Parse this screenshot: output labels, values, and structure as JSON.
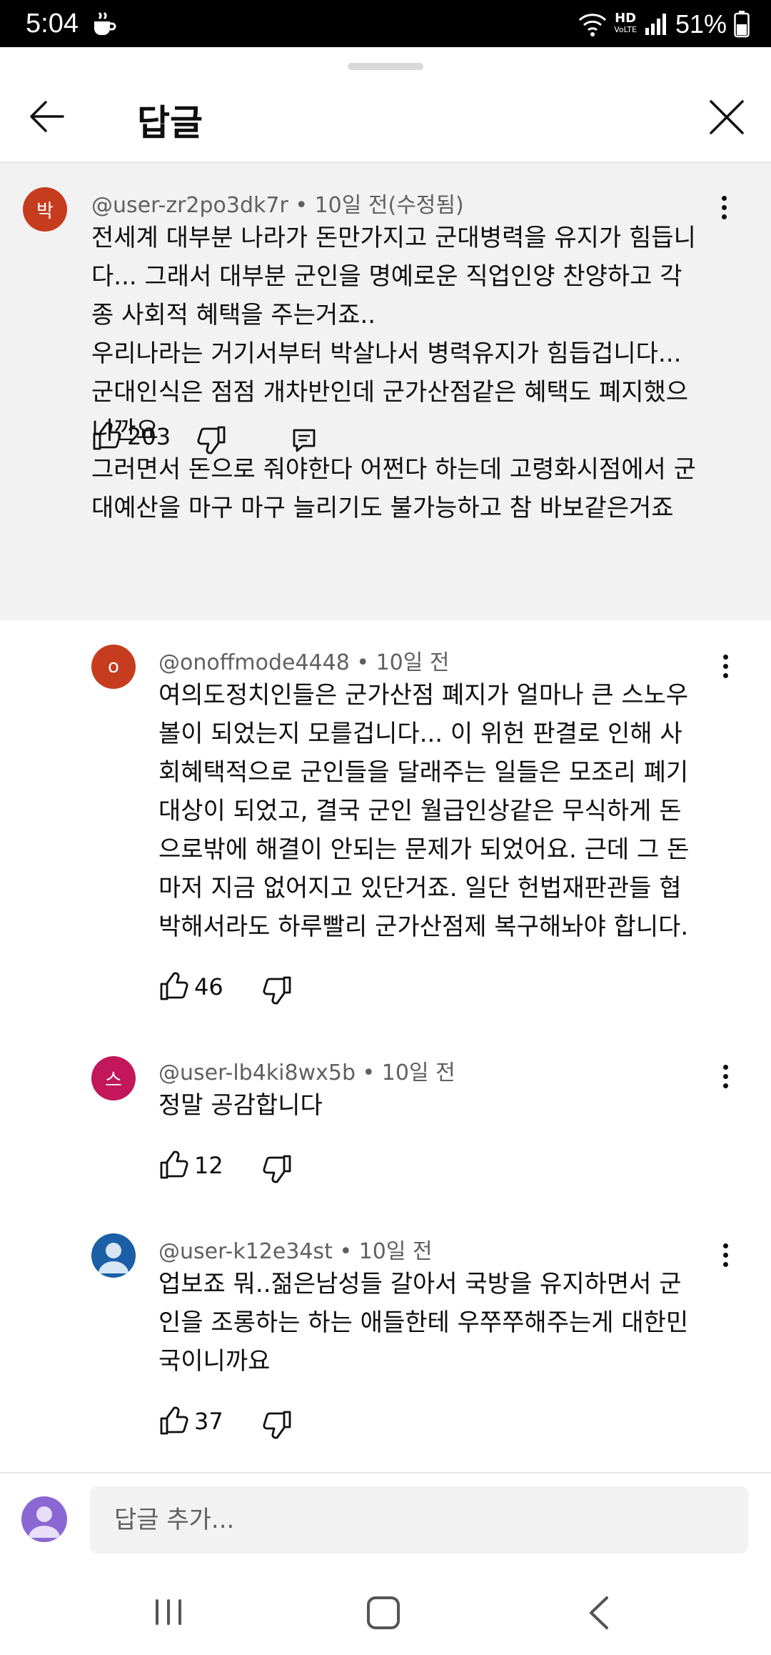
{
  "status_bar": {
    "time": "5:04",
    "hd_label": "HD",
    "hd_sub": "VoLTE",
    "battery": "51%"
  },
  "header": {
    "title": "답글"
  },
  "parent_comment": {
    "avatar_letter": "박",
    "avatar_color": "#c63c1e",
    "meta": "@user-zr2po3dk7r • 10일 전(수정됨)",
    "lines": [
      "전세계 대부분 나라가 돈만가지고 군대병력을 유지가 힘듭니",
      "다... 그래서 대부분 군인을 명예로운 직업인양 찬양하고 각",
      "종 사회적 혜택을 주는거죠..",
      "우리나라는 거기서부터 박살나서 병력유지가 힘듭겁니다...",
      "군대인식은 점점 개차반인데 군가산점같은 혜택도 폐지했으",
      "니깐요",
      "그러면서 돈으로 줘야한다 어쩐다 하는데 고령화시점에서 군",
      "대예산을 마구 마구 늘리기도 불가능하고 참 바보같은거죠"
    ],
    "likes": "203"
  },
  "replies": [
    {
      "avatar_letter": "o",
      "avatar_color": "#c63c1e",
      "meta": "@onoffmode4448 • 10일 전",
      "lines": [
        "여의도정치인들은 군가산점 폐지가 얼마나 큰 스노우",
        "볼이 되었는지 모를겁니다... 이 위헌 판결로 인해 사",
        "회혜택적으로 군인들을 달래주는 일들은 모조리 폐기",
        "대상이 되었고, 결국 군인 월급인상같은 무식하게 돈",
        "으로밖에 해결이 안되는 문제가 되었어요. 근데 그 돈",
        "마저 지금 없어지고 있단거죠. 일단 헌법재판관들 협",
        "박해서라도 하루빨리 군가산점제 복구해놔야 합니다."
      ],
      "likes": "46"
    },
    {
      "avatar_letter": "스",
      "avatar_color": "#c2185b",
      "meta": "@user-lb4ki8wx5b • 10일 전",
      "lines": [
        "정말 공감합니다"
      ],
      "likes": "12"
    },
    {
      "avatar_letter": "",
      "avatar_color": "#1b5fa6",
      "meta": "@user-k12e34st • 10일 전",
      "lines": [
        "업보죠 뭐..젊은남성들 갈아서 국방을 유지하면서 군",
        "인을 조롱하는 하는 애들한테 우쭈쭈해주는게 대한민",
        "국이니까요"
      ],
      "likes": "37"
    }
  ],
  "reply_input": {
    "placeholder": "답글 추가..."
  }
}
